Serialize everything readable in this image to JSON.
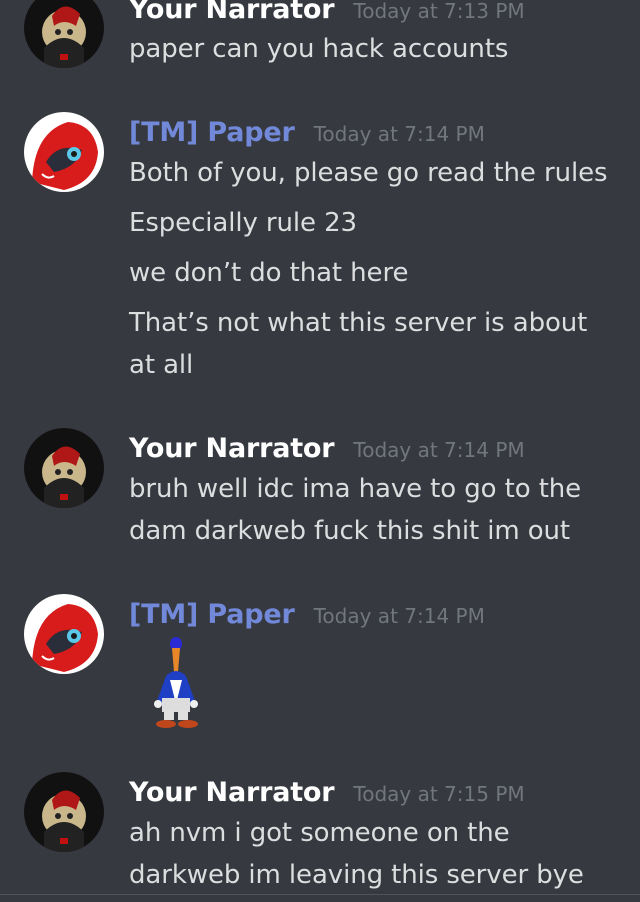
{
  "colors": {
    "background": "#36393f",
    "text": "#dcddde",
    "username_default": "#ffffff",
    "username_role": "#7289da",
    "timestamp": "#72767d"
  },
  "messages": [
    {
      "username": "Your Narrator",
      "timestamp": "Today at 7:13 PM",
      "lines": [
        "paper can you hack accounts"
      ],
      "avatar_icon": "narrator-avatar"
    },
    {
      "username": "[TM] Paper",
      "timestamp": "Today at 7:14 PM",
      "lines": [
        "Both of you, please go read the rules",
        "Especially rule 23",
        "we don’t do that here",
        "That’s not what this server is about",
        "at all"
      ],
      "avatar_icon": "paper-avatar"
    },
    {
      "username": "Your Narrator",
      "timestamp": "Today at 7:14 PM",
      "lines": [
        "bruh well idc ima have to go to the",
        "dam darkweb fuck this shit  im out"
      ],
      "avatar_icon": "narrator-avatar"
    },
    {
      "username": "[TM] Paper",
      "timestamp": "Today at 7:14 PM",
      "lines": [],
      "sticker_icon": "penguin-sticker",
      "avatar_icon": "paper-avatar"
    },
    {
      "username": "Your Narrator",
      "timestamp": "Today at 7:15 PM",
      "lines": [
        "ah nvm i got someone on the",
        "darkweb im leaving this server bye"
      ],
      "avatar_icon": "narrator-avatar"
    }
  ]
}
